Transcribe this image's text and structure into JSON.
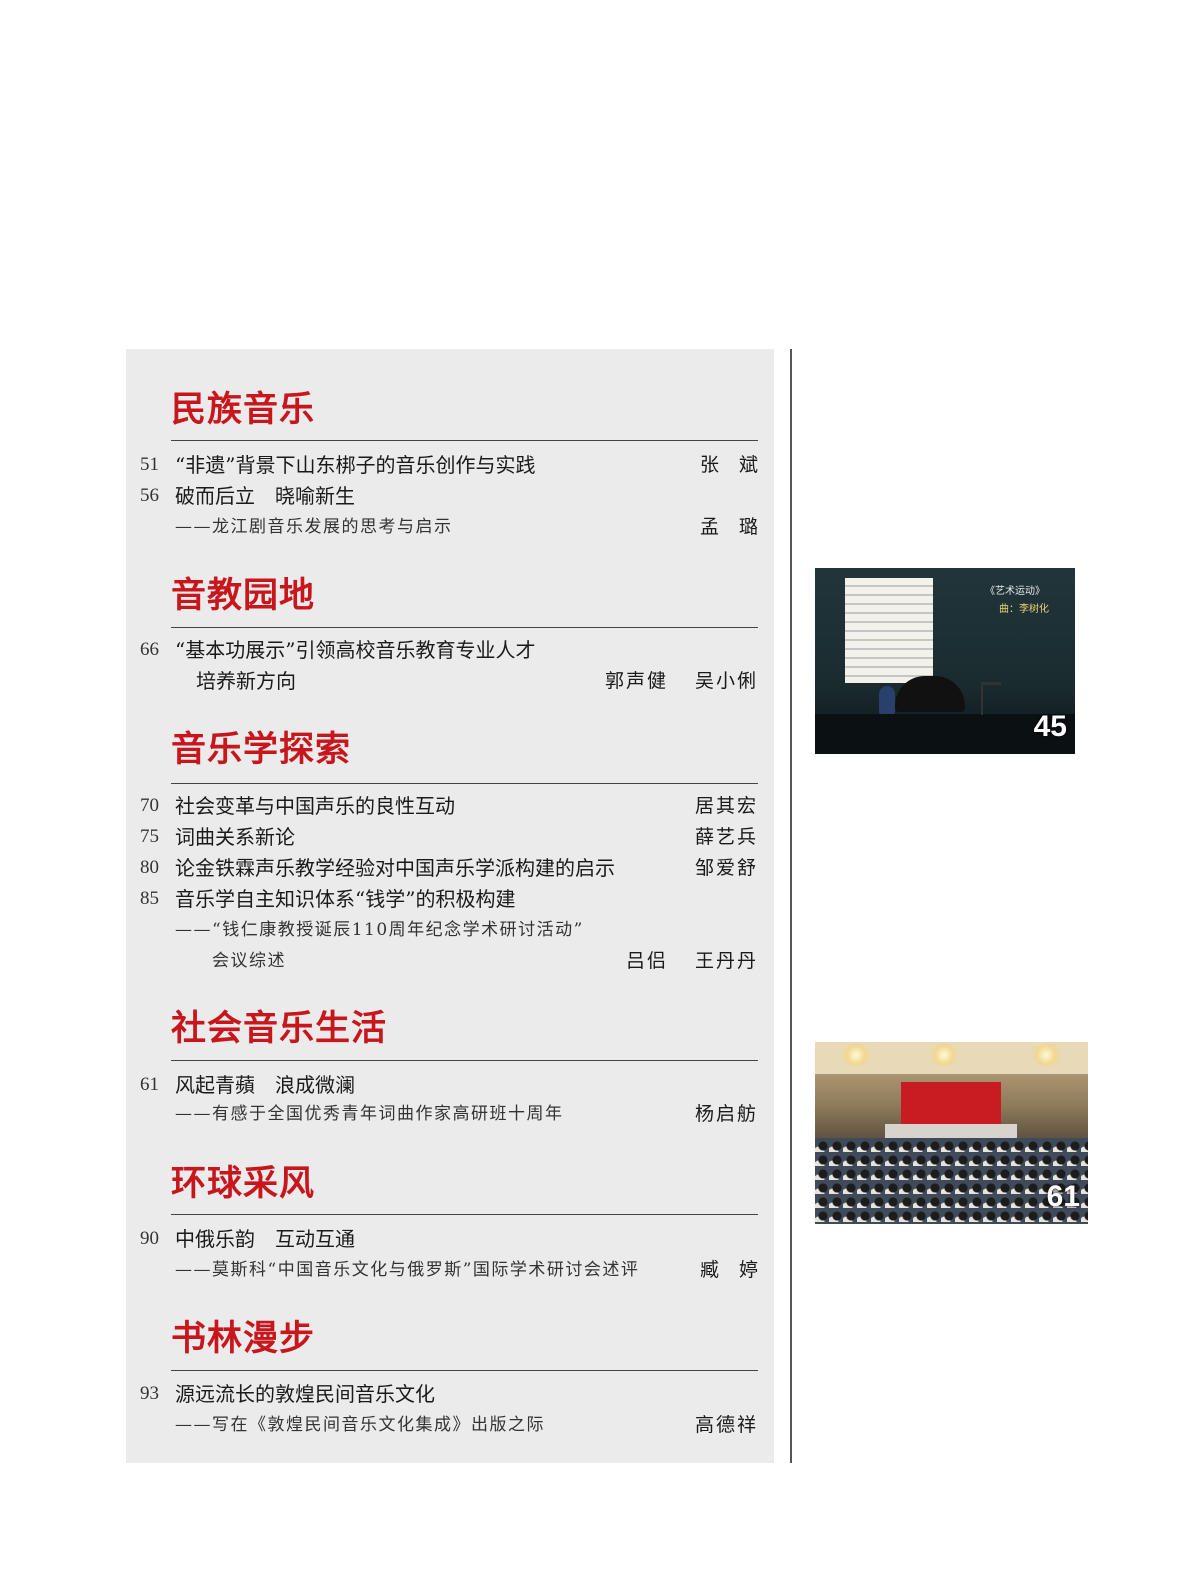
{
  "sections": [
    {
      "title": "民族音乐",
      "entries": [
        {
          "page": "51",
          "title": "“非遗”背景下山东梆子的音乐创作与实践",
          "author": "张斌"
        },
        {
          "page": "56",
          "title": "破而后立　晓喻新生",
          "subtitle": "——龙江剧音乐发展的思考与启示",
          "author": "孟璐"
        }
      ]
    },
    {
      "title": "音教园地",
      "entries": [
        {
          "page": "66",
          "title": "“基本功展示”引领高校音乐教育专业人才",
          "title_line2": "培养新方向",
          "author": "郭声健",
          "author2": "吴小俐"
        }
      ]
    },
    {
      "title": "音乐学探索",
      "entries": [
        {
          "page": "70",
          "title": "社会变革与中国声乐的良性互动",
          "author": "居其宏"
        },
        {
          "page": "75",
          "title": "词曲关系新论",
          "author": "薛艺兵"
        },
        {
          "page": "80",
          "title": "论金铁霖声乐教学经验对中国声乐学派构建的启示",
          "author": "邹爱舒"
        },
        {
          "page": "85",
          "title": "音乐学自主知识体系“钱学”的积极构建",
          "subtitle": "——“钱仁康教授诞辰110周年纪念学术研讨活动”",
          "subtitle_line2": "会议综述",
          "author": "吕侣",
          "author2": "王丹丹"
        }
      ]
    },
    {
      "title": "社会音乐生活",
      "entries": [
        {
          "page": "61",
          "title": "风起青蘋　浪成微澜",
          "subtitle": "——有感于全国优秀青年词曲作家高研班十周年",
          "author": "杨启舫"
        }
      ]
    },
    {
      "title": "环球采风",
      "entries": [
        {
          "page": "90",
          "title": "中俄乐韵　互动互通",
          "subtitle": "——莫斯科“中国音乐文化与俄罗斯”国际学术研讨会述评",
          "author": "臧婷"
        }
      ]
    },
    {
      "title": "书林漫步",
      "entries": [
        {
          "page": "93",
          "title": "源远流长的敦煌民间音乐文化",
          "subtitle": "——写在《敦煌民间音乐文化集成》出版之际",
          "author": "高德祥"
        }
      ]
    }
  ],
  "photos": [
    {
      "page_number": "45",
      "caption_title": "《艺术运动》",
      "caption_composer": "曲：李树化"
    },
    {
      "page_number": "61"
    }
  ],
  "colors": {
    "section_title": "#c8161d",
    "panel_background": "#ebebeb"
  }
}
